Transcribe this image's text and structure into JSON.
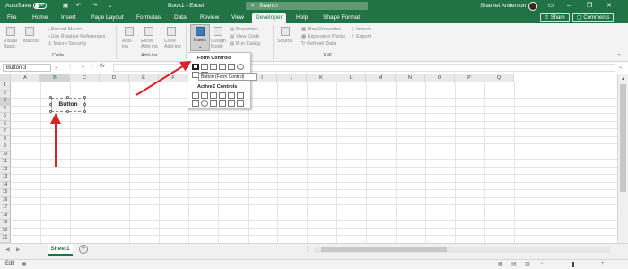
{
  "titlebar": {
    "autosave_label": "AutoSave",
    "autosave_state": "Off",
    "workbook_title": "Book1 - Excel",
    "search_placeholder": "Search",
    "user_name": "Shantel Anderson"
  },
  "tabs": [
    "File",
    "Home",
    "Insert",
    "Page Layout",
    "Formulas",
    "Data",
    "Review",
    "View",
    "Developer",
    "Help",
    "Shape Format"
  ],
  "active_tab": "Developer",
  "share_label": "Share",
  "comments_label": "Comments",
  "ribbon": {
    "code": {
      "label": "Code",
      "visual_basic": "Visual Basic",
      "macros": "Macros",
      "record_macro": "Record Macro",
      "relative_refs": "Use Relative References",
      "macro_security": "Macro Security"
    },
    "addins": {
      "label": "Add-ins",
      "addins": "Add-ins",
      "excel_addins": "Excel Add-ins",
      "com_addins": "COM Add-ins"
    },
    "controls": {
      "insert": "Insert",
      "design_mode": "Design Mode",
      "properties": "Properties",
      "view_code": "View Code",
      "run_dialog": "Run Dialog"
    },
    "xml": {
      "label": "XML",
      "source": "Source",
      "map_properties": "Map Properties",
      "expansion_packs": "Expansion Packs",
      "refresh_data": "Refresh Data",
      "import": "Import",
      "export": "Export"
    }
  },
  "formula_bar": {
    "name_box": "Button 3",
    "fx": "fx"
  },
  "columns": [
    "A",
    "B",
    "C",
    "D",
    "E",
    "F",
    "G",
    "H",
    "I",
    "J",
    "K",
    "L",
    "M",
    "N",
    "O",
    "P",
    "Q"
  ],
  "rows": [
    "1",
    "2",
    "3",
    "4",
    "5",
    "6",
    "7",
    "8",
    "9",
    "10",
    "11",
    "12",
    "13",
    "14",
    "15",
    "16",
    "17",
    "18",
    "19",
    "20",
    "21"
  ],
  "button_control_label": "Button",
  "dropdown": {
    "form_controls_label": "Form Controls",
    "activex_controls_label": "ActiveX Controls",
    "tooltip": "Button (Form Control)"
  },
  "sheet_tab": "Sheet1",
  "status": "Edit",
  "colors": {
    "excel_green": "#217346",
    "arrow_red": "#d9222a"
  }
}
